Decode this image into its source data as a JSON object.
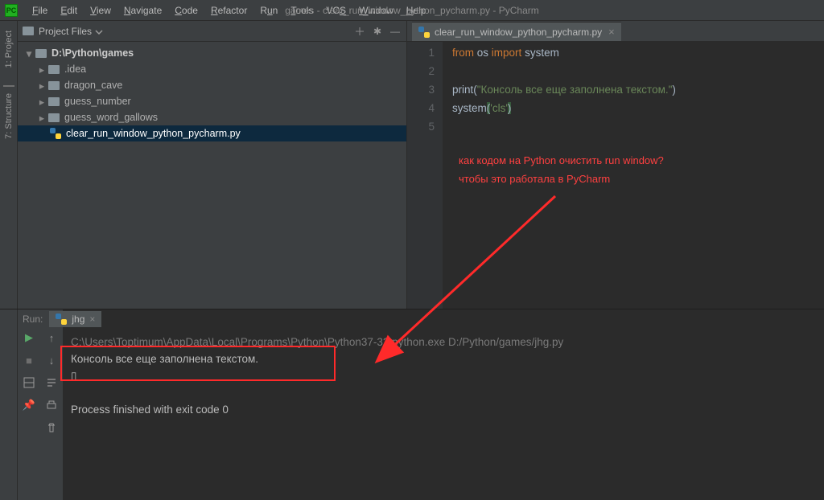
{
  "window_title": "games - clear_run_window_python_pycharm.py - PyCharm",
  "menus": [
    "File",
    "Edit",
    "View",
    "Navigate",
    "Code",
    "Refactor",
    "Run",
    "Tools",
    "VCS",
    "Window",
    "Help"
  ],
  "project_panel": {
    "title": "Project Files",
    "root": "D:\\Python\\games",
    "items": [
      {
        "name": ".idea",
        "type": "folder"
      },
      {
        "name": "dragon_cave",
        "type": "folder"
      },
      {
        "name": "guess_number",
        "type": "folder"
      },
      {
        "name": "guess_word_gallows",
        "type": "folder"
      },
      {
        "name": "clear_run_window_python_pycharm.py",
        "type": "py",
        "selected": true
      }
    ]
  },
  "side_tabs": [
    "1: Project",
    "7: Structure"
  ],
  "editor": {
    "tab_name": "clear_run_window_python_pycharm.py",
    "lines": [
      {
        "n": "1"
      },
      {
        "n": "2"
      },
      {
        "n": "3"
      },
      {
        "n": "4"
      },
      {
        "n": "5"
      }
    ],
    "code": {
      "l1_from": "from",
      "l1_os": "os",
      "l1_import": "import",
      "l1_system": "system",
      "l3_print": "print",
      "l3_str": "\"Консоль все еще заполнена текстом.\"",
      "l4_system": "system",
      "l4_arg": "'cls'"
    }
  },
  "annotation": {
    "line1": "как кодом на Python очистить run window?",
    "line2": "чтобы это работала в PyCharm"
  },
  "run": {
    "label": "Run:",
    "tab": "jhg",
    "cmd": "C:\\Users\\Toptimum\\AppData\\Local\\Programs\\Python\\Python37-32\\python.exe D:/Python/games/jhg.py",
    "out1": "Консоль все еще заполнена текстом.",
    "out2": "\u0000",
    "exit": "Process finished with exit code 0"
  }
}
